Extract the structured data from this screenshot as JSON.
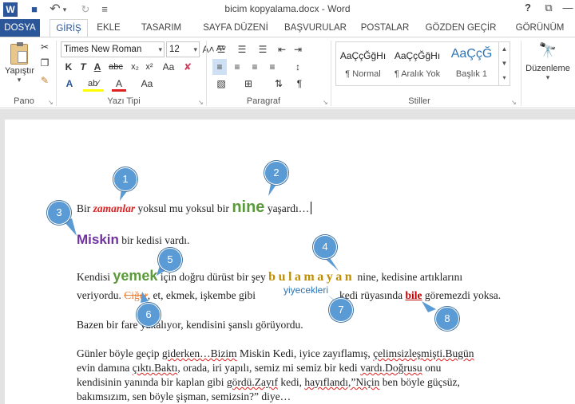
{
  "titlebar": {
    "app_icon": "W",
    "title": "bicim kopyalama.docx - Word",
    "help": "?",
    "ribbon_display": "⧉",
    "minimize": "—",
    "save_icon": "■",
    "undo_icon": "↶",
    "undo_dropdown": "▾",
    "redo_icon": "↻",
    "customize_icon": "≡"
  },
  "tabs": [
    "DOSYA",
    "GİRİŞ",
    "EKLE",
    "TASARIM",
    "SAYFA DÜZENİ",
    "BAŞVURULAR",
    "POSTALAR",
    "GÖZDEN GEÇİR",
    "GÖRÜNÜM"
  ],
  "ribbon": {
    "paste_label": "Yapıştır",
    "paste_arrow": "▾",
    "cut": "✂",
    "copy": "❐",
    "format_painter": "✎",
    "group_pano": "Pano",
    "font_name": "Times New Roman",
    "font_size": "12",
    "dropdown_arrow": "▾",
    "grow_font": "A˄",
    "shrink_font": "A˅",
    "case_button": "Aa",
    "clear_format": "✘",
    "bold": "K",
    "italic": "T",
    "underline": "A",
    "strike": "abc",
    "subscript": "x₂",
    "superscript": "x²",
    "text_effects": "A",
    "highlight": "ab⁄",
    "font_color": "A",
    "font_case": "Aa",
    "group_yazi_tipi": "Yazı Tipi",
    "bullets": "☰",
    "numbering": "☰",
    "multilevel": "☰",
    "decrease_indent": "⇤",
    "increase_indent": "⇥",
    "sort": "⇅",
    "pilcrow": "¶",
    "align_left": "≡",
    "align_center": "≡",
    "align_right": "≡",
    "justify": "≡",
    "line_spacing": "↕",
    "shading": "▧",
    "borders": "⊞",
    "group_paragraf": "Paragraf",
    "styles": [
      {
        "preview": "AaÇçĞğHı",
        "name": "¶ Normal"
      },
      {
        "preview": "AaÇçĞğHı",
        "name": "¶ Aralık Yok"
      },
      {
        "preview": "AaÇçĞ",
        "name": "Başlık 1"
      }
    ],
    "styles_up": "▲",
    "styles_down": "▼",
    "styles_more": "▾",
    "group_stiller": "Stiller",
    "edit_icon": "🔭",
    "edit_label": "Düzenleme",
    "edit_arrow": "▾",
    "launcher": "↘"
  },
  "document": {
    "l1_a": "Bir ",
    "l1_b": "zamanlar",
    "l1_c": " yoksul mu yoksul bir ",
    "l1_d": "nine",
    "l1_e": " yaşardı…",
    "l2_a": "Miskin",
    "l2_b": " bir kedisi vardı.",
    "l3_a": "Kendisi ",
    "l3_b": "yemek",
    "l3_c": " için doğru dürüst bir şey ",
    "l3_d": "bulamayan",
    "l3_e": " nine, kedisine artıklarını",
    "l4_a": "veriyordu. ",
    "l4_b": "Ciğer",
    "l4_c": ", et, ekmek, işkembe gibi ",
    "l4_d": "yiyecekleri",
    "l4_e": " kedi rüyasında ",
    "l4_f": "bile",
    "l4_g": " göremezdi yoksa.",
    "l5": "Bazen bir fare yakalıyor, kendisini şanslı görüyordu.",
    "p6_1a": "Günler böyle geçip ",
    "p6_1b": "giderken…Bizim",
    "p6_1c": " Miskin Kedi, iyice zayıflamış, ",
    "p6_1d": "çelimsizleşmişti.Bugün",
    "p6_2a": "evin damına ",
    "p6_2b": "çıktı.Baktı",
    "p6_2c": ", orada, iri yapılı, semiz mi semiz bir kedi ",
    "p6_2d": "vardı.Doğrusu",
    "p6_2e": " onu",
    "p6_3a": "kendisinin yanında bir kaplan gibi ",
    "p6_3b": "gördü.Zayıf",
    "p6_3c": " kedi, ",
    "p6_3d": "hayıflandı,”Niçin",
    "p6_3e": " ben böyle güçsüz,",
    "p6_4": "bakımsızım,  sen böyle şişman, semizsin?”  diye…"
  },
  "callouts": [
    "1",
    "2",
    "3",
    "4",
    "5",
    "6",
    "7",
    "8"
  ],
  "colors": {
    "accent": "#2b579a",
    "callout": "#5b9bd5"
  }
}
